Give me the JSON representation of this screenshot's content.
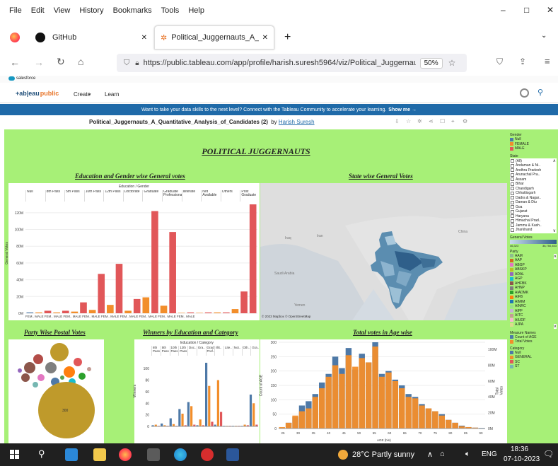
{
  "menu": [
    "File",
    "Edit",
    "View",
    "History",
    "Bookmarks",
    "Tools",
    "Help"
  ],
  "window_controls": {
    "min": "–",
    "max": "□",
    "close": "✕"
  },
  "tabs": [
    {
      "title": "GitHub",
      "close": "✕"
    },
    {
      "title": "Political_Juggernauts_A_Quantit",
      "close": "✕"
    }
  ],
  "new_tab": "+",
  "url": "https://public.tableau.com/app/profile/harish.suresh5964/viz/Political_Juggernaut",
  "zoom": "50%",
  "bookmark": "salesforce",
  "tableau": {
    "logo": "+ab|eau",
    "logo_public": "public",
    "nav": [
      "Create",
      "Learn"
    ],
    "banner": "Want to take your data skills to the next level? Connect with the Tableau Community to accelerate your learning.",
    "banner_link": "Show me →",
    "viz_title": "Political_Juggernauts_A_Quantitative_Analysis_of_Candidates (2)",
    "by": "by",
    "author": "Harish Suresh"
  },
  "dashboard": {
    "title": "POLITICAL  JUGGERNAUTS",
    "sec_edu": "Education and Gender wise General votes",
    "sec_state": "State wise General Votes",
    "sec_postal": "Party Wise Postal Votes",
    "sec_winners": "Winners by Education and Category",
    "sec_age": "Total votes in Age wise",
    "edu_header": "Education / Gender",
    "edu_ylabel": "General Votes",
    "edu_cols": [
      "Null",
      "8th Pass",
      "5th Pass",
      "10th Pass",
      "12th Pass",
      "Doctorate",
      "Graduate",
      "Graduate Professional",
      "Illiterate",
      "Not Available",
      "Others",
      "Post Graduate"
    ],
    "edu_yticks": [
      "0M",
      "20M",
      "40M",
      "60M",
      "80M",
      "100M",
      "120M"
    ],
    "edu_gender_row": "FEM.. MALE FEM.. MALE FEM.. MALE FEM.. MALE FEM.. MALE FEM.. MALE FEM.. MALE FEM.. MALE FEM.. MALE",
    "map_labels": [
      "Iran",
      "Iraq",
      "Saudi Arabia",
      "Yemen",
      "China"
    ],
    "map_credit": "© 2023 Mapbox  © OpenStreetMap",
    "postal_big": "300",
    "winners_header": "Education / Category",
    "winners_ylabel": "Winners",
    "winners_cols": [
      "8th Pass",
      "5th Pass",
      "10th Pass",
      "12th Pass",
      "Doc..",
      "Gra..",
      "Grad Prof..",
      "Illit..",
      "Lite..",
      "Not..",
      "Oth..",
      "Gra.."
    ],
    "winners_yticks": [
      "0",
      "20",
      "40",
      "60",
      "80",
      "100"
    ],
    "age_ylabel": "Count of AGE",
    "age_y2label": "Total Votes",
    "age_xlabel": "AGE (bin)",
    "age_yticks": [
      "0",
      "50",
      "100",
      "150",
      "200",
      "250",
      "300"
    ],
    "age_y2ticks": [
      "0M",
      "20M",
      "40M",
      "60M",
      "80M",
      "100M"
    ],
    "age_xticks": [
      "25",
      "30",
      "35",
      "40",
      "45",
      "50",
      "55",
      "60",
      "65",
      "70",
      "75",
      "80",
      "85",
      "90"
    ]
  },
  "sidebar": {
    "gender_title": "Gender",
    "gender": [
      {
        "name": "Null",
        "color": "#4e79a7"
      },
      {
        "name": "FEMALE",
        "color": "#f28e2b"
      },
      {
        "name": "MALE",
        "color": "#e15759"
      }
    ],
    "state_title": "State",
    "states": [
      "(All)",
      "Andaman & Ni..",
      "Andhra Pradesh",
      "Arunachal Pra..",
      "Assam",
      "Bihar",
      "Chandigarh",
      "Chhattisgarh",
      "Dadra & Nagar..",
      "Daman & Diu",
      "Goa",
      "Gujarat",
      "Haryana",
      "Himachal Prad..",
      "Jammu & Kash..",
      "Jharkhand"
    ],
    "gv_title": "General Votes",
    "gv_min": "46,323",
    "gv_max": "38,750,453",
    "party_title": "Party",
    "parties": [
      {
        "name": "AAM",
        "color": "#8fbc8f"
      },
      {
        "name": "AAP",
        "color": "#d2691e"
      },
      {
        "name": "ABGP",
        "color": "#e377c2"
      },
      {
        "name": "ABSKP",
        "color": "#bcbd22"
      },
      {
        "name": "ADAL",
        "color": "#9467bd"
      },
      {
        "name": "AGP",
        "color": "#17becf"
      },
      {
        "name": "AHFBK",
        "color": "#8c564b"
      },
      {
        "name": "AHNP",
        "color": "#7f7f7f"
      },
      {
        "name": "AIADMK",
        "color": "#2ca02c"
      },
      {
        "name": "AIFB",
        "color": "#ff7f0e"
      },
      {
        "name": "AIMIM",
        "color": "#1f77b4"
      },
      {
        "name": "AINRC",
        "color": "#98df8a"
      },
      {
        "name": "AIPF",
        "color": "#c5b0d5"
      },
      {
        "name": "AITC",
        "color": "#c49c94"
      },
      {
        "name": "AIUDF",
        "color": "#f7b6d2"
      },
      {
        "name": "AJPA",
        "color": "#dbdb8d"
      }
    ],
    "mn_title": "Measure Names",
    "measures": [
      {
        "name": "Count of AGE",
        "color": "#4e79a7"
      },
      {
        "name": "Total Votes",
        "color": "#f28e2b"
      }
    ],
    "cat_title": "Category",
    "categories": [
      {
        "name": "Null",
        "color": "#4e79a7"
      },
      {
        "name": "GENERAL",
        "color": "#f28e2b"
      },
      {
        "name": "SC",
        "color": "#e15759"
      },
      {
        "name": "ST",
        "color": "#76b7b2"
      }
    ]
  },
  "taskbar": {
    "weather": "28°C  Partly sunny",
    "lang": "ENG",
    "time": "18:36",
    "date": "07-10-2023"
  },
  "chart_data": [
    {
      "type": "bar",
      "title": "Education and Gender wise General votes",
      "xlabel": "Education / Gender",
      "ylabel": "General Votes",
      "ylim": [
        0,
        130
      ],
      "categories": [
        "Null",
        "8th Pass F",
        "8th Pass M",
        "5th Pass F",
        "5th Pass M",
        "10th Pass F",
        "10th Pass M",
        "12th Pass F",
        "12th Pass M",
        "Doctorate F",
        "Doctorate M",
        "Graduate F",
        "Graduate M",
        "Grad Prof F",
        "Grad Prof M",
        "Illiterate F",
        "Illiterate M",
        "Literate F",
        "Literate M",
        "Not Available F",
        "Not Available M",
        "Others F",
        "Others M",
        "Post Graduate F",
        "Post Graduate M"
      ],
      "values": [
        1,
        1,
        3,
        1,
        3,
        2,
        13,
        4,
        47,
        10,
        59,
        3,
        17,
        19,
        122,
        9,
        97,
        0.5,
        1,
        0.5,
        1,
        1,
        1,
        5,
        26,
        130
      ],
      "colors": [
        "#4e79a7",
        "#f28e2b",
        "#e15759",
        "#f28e2b",
        "#e15759",
        "#f28e2b",
        "#e15759",
        "#f28e2b",
        "#e15759",
        "#f28e2b",
        "#e15759",
        "#f28e2b",
        "#e15759",
        "#f28e2b",
        "#e15759",
        "#f28e2b",
        "#e15759",
        "#f28e2b",
        "#e15759",
        "#f28e2b",
        "#e15759",
        "#f28e2b",
        "#e15759",
        "#f28e2b",
        "#e15759"
      ]
    },
    {
      "type": "bar",
      "title": "Winners by Education and Category",
      "ylabel": "Winners",
      "ylim": [
        0,
        110
      ],
      "values": [
        2,
        3,
        1,
        5,
        2,
        1,
        14,
        4,
        1,
        30,
        22,
        2,
        42,
        35,
        3,
        2,
        12,
        2,
        110,
        70,
        8,
        3,
        80,
        25,
        1,
        1,
        1,
        1,
        1,
        1,
        1,
        3,
        2,
        55,
        40,
        3
      ],
      "colors_cycle": [
        "#4e79a7",
        "#f28e2b",
        "#e15759"
      ]
    },
    {
      "type": "bar",
      "title": "Total votes in Age wise",
      "xlabel": "AGE (bin)",
      "ylabel": "Count of AGE",
      "ylim": [
        0,
        300
      ],
      "x": [
        25,
        27,
        29,
        31,
        33,
        35,
        37,
        39,
        41,
        43,
        45,
        47,
        49,
        51,
        53,
        55,
        57,
        59,
        61,
        63,
        65,
        67,
        69,
        71,
        73,
        75,
        77,
        79,
        81,
        83,
        85
      ],
      "series": [
        {
          "name": "Count of AGE",
          "values": [
            0,
            20,
            40,
            80,
            95,
            120,
            160,
            190,
            250,
            210,
            280,
            205,
            260,
            230,
            300,
            190,
            200,
            170,
            150,
            120,
            110,
            85,
            70,
            60,
            50,
            30,
            20,
            10,
            5,
            3,
            2
          ]
        },
        {
          "name": "Total Votes",
          "values": [
            5,
            20,
            45,
            60,
            70,
            110,
            140,
            180,
            220,
            190,
            255,
            215,
            245,
            230,
            285,
            180,
            195,
            165,
            140,
            110,
            105,
            80,
            70,
            60,
            45,
            30,
            20,
            8,
            5,
            3,
            1
          ]
        }
      ]
    }
  ]
}
